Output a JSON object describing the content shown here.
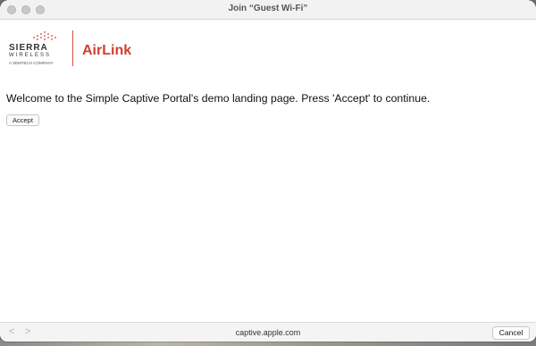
{
  "window": {
    "title": "Join “Guest Wi-Fi”"
  },
  "header": {
    "sierra_line1": "SIERRA",
    "sierra_line2": "WIRELESS",
    "sierra_line3": "A SEMTECH COMPANY",
    "airlink": "AirLink"
  },
  "main": {
    "welcome_text": "Welcome to the Simple Captive Portal's demo landing page. Press 'Accept' to continue.",
    "accept_label": "Accept"
  },
  "bottombar": {
    "back_glyph": "<",
    "forward_glyph": ">",
    "url": "captive.apple.com",
    "cancel_label": "Cancel"
  },
  "colors": {
    "brand_red": "#d0402f",
    "titlebar": "#f2f2f2"
  }
}
